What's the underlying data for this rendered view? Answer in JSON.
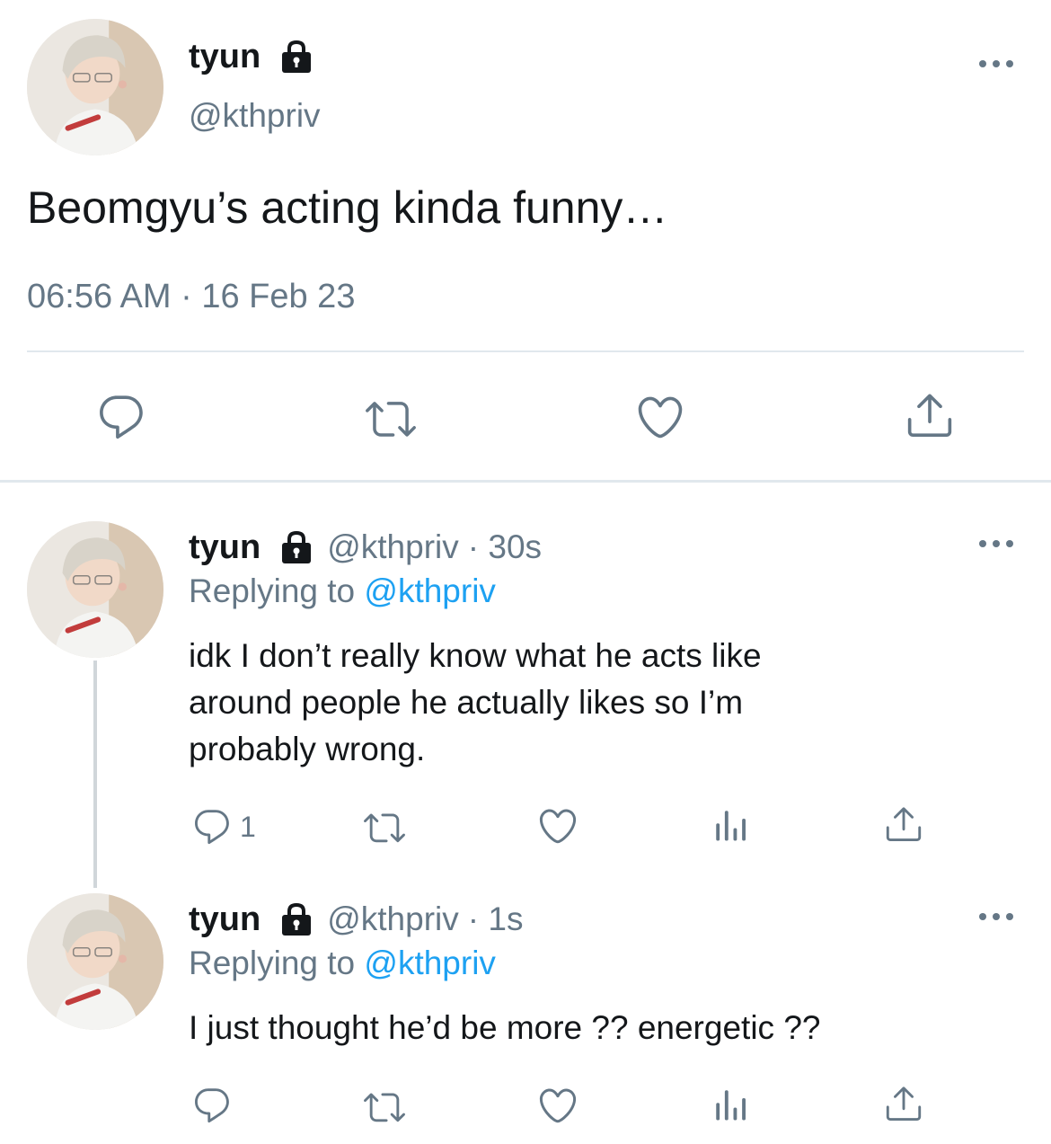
{
  "main_tweet": {
    "display_name": "tyun",
    "handle": "@kthpriv",
    "text": "Beomgyu’s acting kinda funny…",
    "timestamp": "06:56 AM · 16 Feb 23",
    "actions": [
      "reply-icon",
      "retweet-icon",
      "like-icon",
      "share-icon"
    ]
  },
  "replies": [
    {
      "display_name": "tyun",
      "handle": "@kthpriv",
      "time": "· 30s",
      "replying_prefix": "Replying to",
      "replying_to": "@kthpriv",
      "text_lines": [
        "idk I don’t really know what he acts like",
        "around people he actually likes so I’m",
        "probably wrong."
      ],
      "reply_count": "1"
    },
    {
      "display_name": "tyun",
      "handle": "@kthpriv",
      "time": "· 1s",
      "replying_prefix": "Replying to",
      "replying_to": "@kthpriv",
      "text_lines": [
        "I just thought he’d be more ?? energetic ??"
      ],
      "reply_count": ""
    }
  ],
  "colors": {
    "text": "#14171a",
    "muted": "#657786",
    "link": "#1da1f2",
    "divider": "#e1e8ed"
  }
}
